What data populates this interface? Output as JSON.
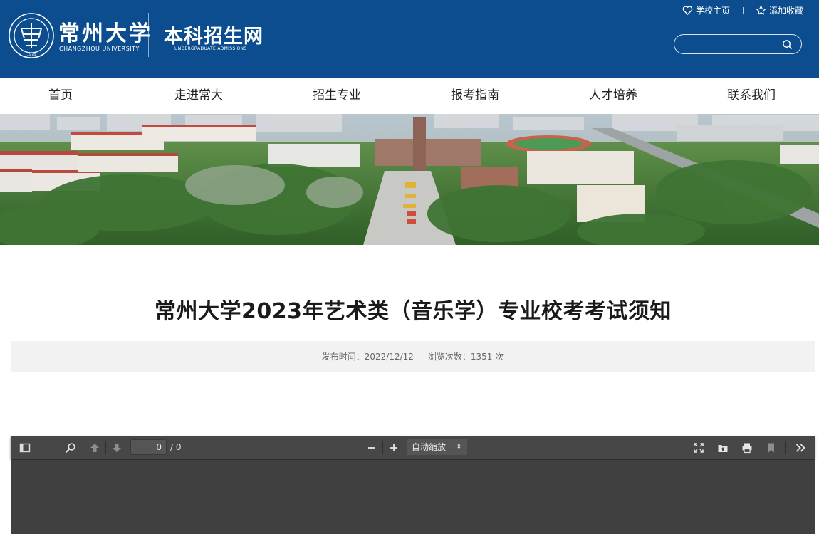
{
  "header": {
    "logo_cn": "常州大学",
    "logo_en": "CHANGZHOU UNIVERSITY",
    "logo_emblem_year": "1978",
    "site_title": "本科招生网",
    "site_subtitle": "UNDERGRADUATE ADMISSIONS",
    "top_links": [
      {
        "label": "学校主页",
        "icon": "heart-icon"
      },
      {
        "label": "添加收藏",
        "icon": "star-icon"
      }
    ],
    "search": {
      "value": "",
      "placeholder": ""
    }
  },
  "nav": {
    "items": [
      "首页",
      "走进常大",
      "招生专业",
      "报考指南",
      "人才培养",
      "联系我们"
    ]
  },
  "banner": {
    "alt": "campus-aerial-photo"
  },
  "article": {
    "title": "常州大学2023年艺术类（音乐学）专业校考考试须知",
    "publish_time": "发布时间：2022/12/12",
    "views": "浏览次数：1351 次"
  },
  "pdf_viewer": {
    "page_value": "0",
    "page_total": "/ 0",
    "zoom_label": "自动缩放",
    "zoom_caret": "⬍"
  },
  "colors": {
    "header_bg": "#0b4d8f",
    "meta_bg": "#f2f2f2",
    "pdf_bg": "#404040",
    "pdf_toolbar": "#474747"
  }
}
